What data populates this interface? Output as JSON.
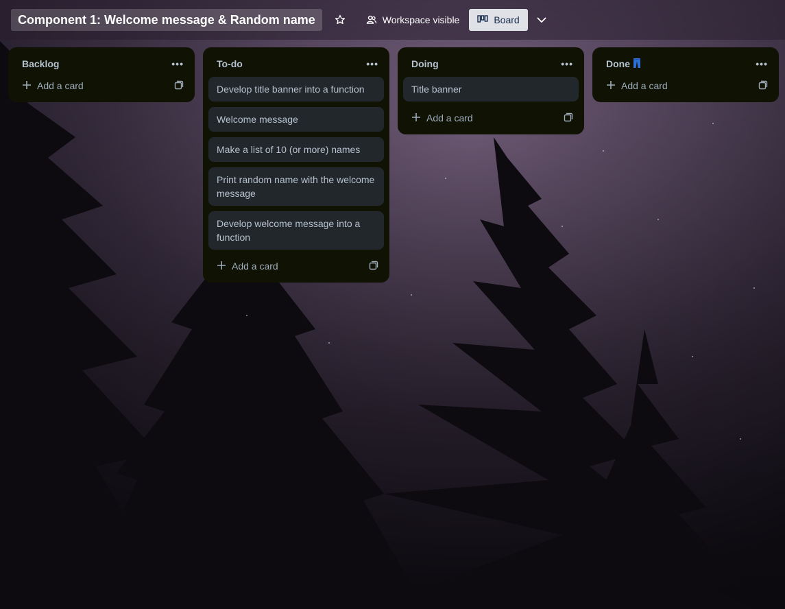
{
  "header": {
    "title": "Component 1: Welcome message & Random name",
    "star_icon": "star-icon",
    "visibility_label": "Workspace visible",
    "visibility_icon": "people-icon",
    "view_label": "Board",
    "view_icon": "board-icon",
    "chevron_icon": "chevron-down-icon"
  },
  "lists": [
    {
      "title": "Backlog",
      "cards": [],
      "add_label": "Add a card"
    },
    {
      "title": "To-do",
      "cards": [
        "Develop title banner into a function",
        "Welcome message",
        "Make a list of 10 (or more) names",
        "Print random name with the welcome message",
        "Develop welcome message into a function"
      ],
      "add_label": "Add a card"
    },
    {
      "title": "Doing",
      "cards": [
        "Title banner"
      ],
      "add_label": "Add a card"
    },
    {
      "title": "Done",
      "cards": [],
      "add_label": "Add a card",
      "title_icon": "jeans-emoji-icon"
    }
  ],
  "colors": {
    "list_bg": "#101204",
    "card_bg": "#22272b",
    "text": "#b6c2cf"
  }
}
